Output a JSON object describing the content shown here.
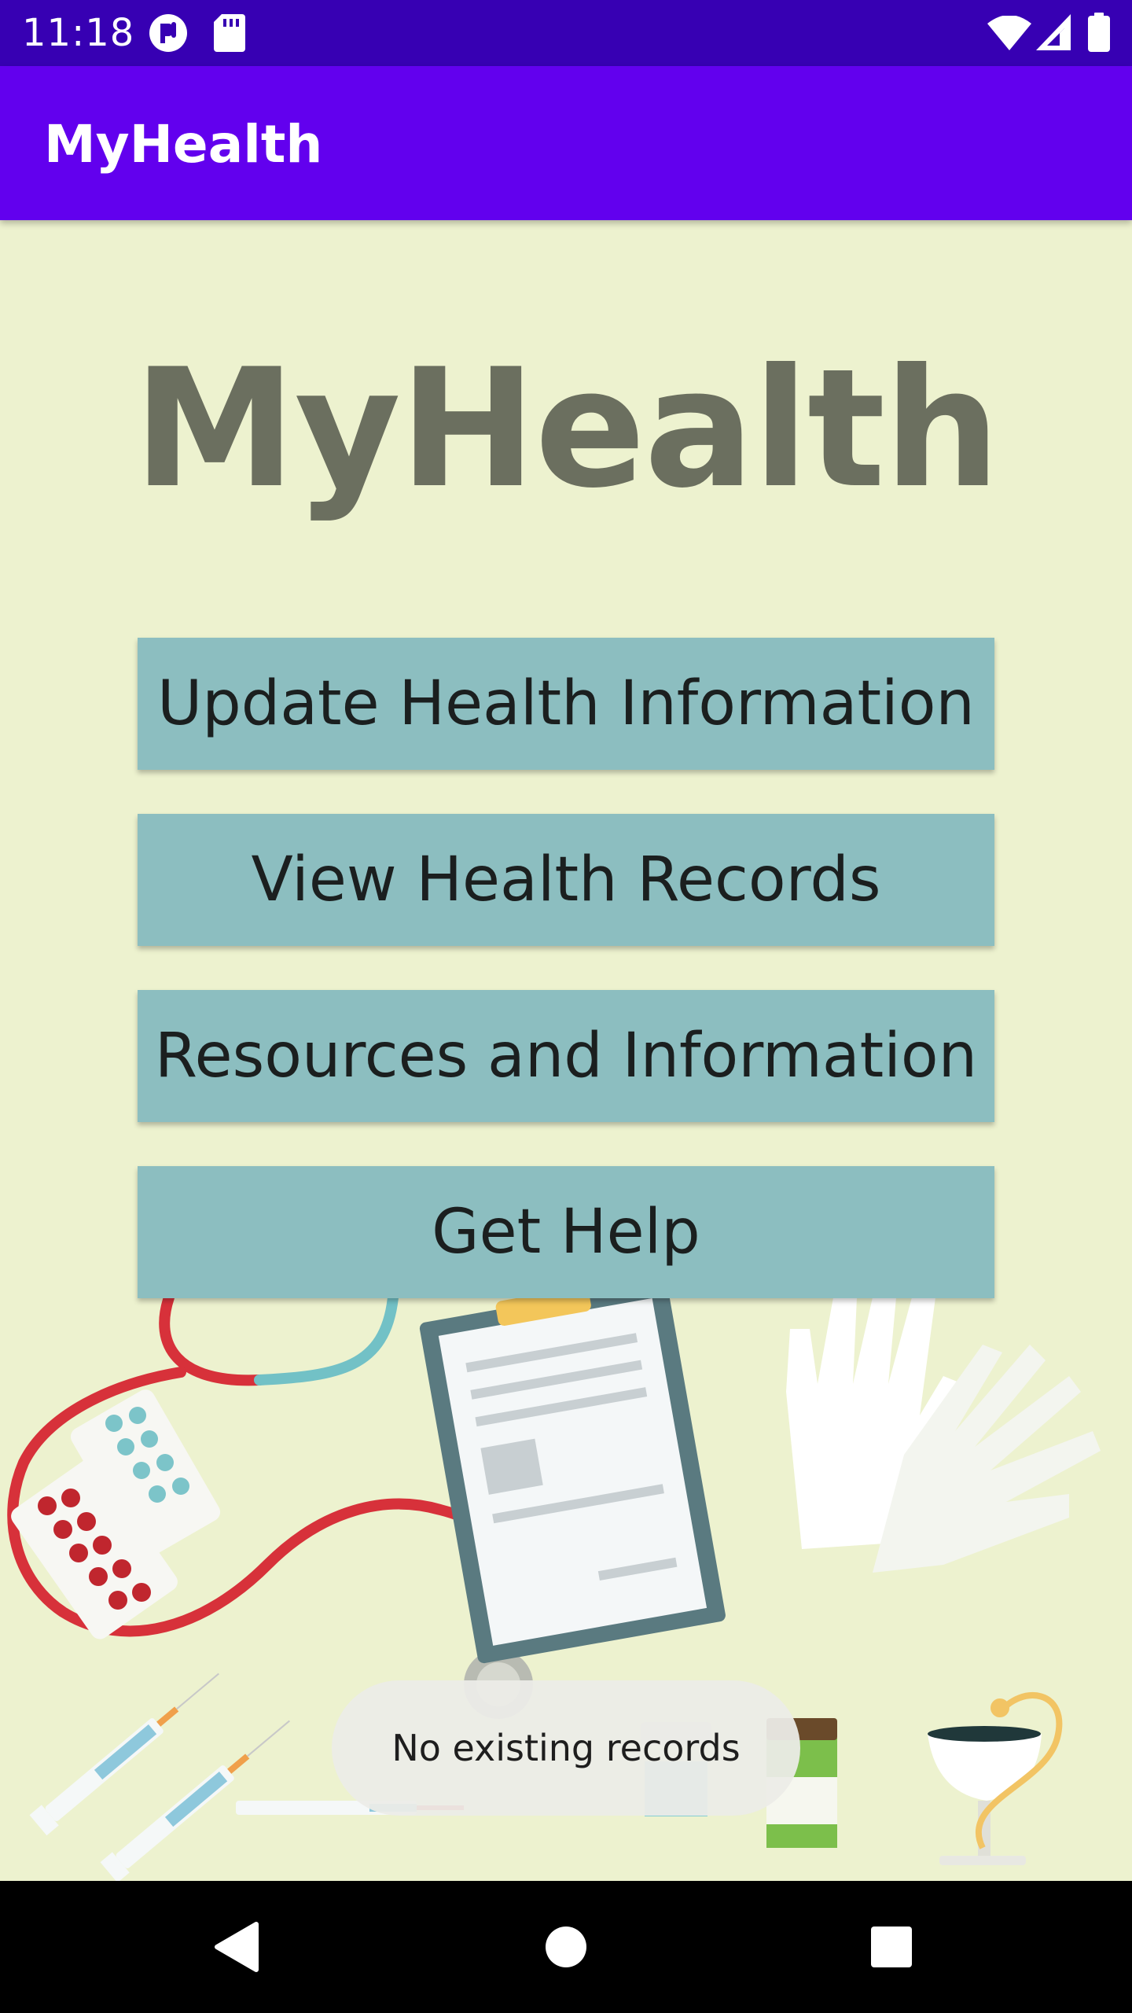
{
  "status_bar": {
    "time": "11:18",
    "icons": [
      "app-notification-icon",
      "sd-card-icon",
      "wifi-icon",
      "cell-signal-icon",
      "battery-icon"
    ]
  },
  "app_bar": {
    "title": "MyHealth"
  },
  "main": {
    "title": "MyHealth",
    "buttons": [
      {
        "label": "Update Health Information"
      },
      {
        "label": "View Health Records"
      },
      {
        "label": "Resources and Information"
      },
      {
        "label": "Get Help"
      }
    ]
  },
  "toast": {
    "message": "No existing records"
  },
  "nav_bar": {
    "buttons": [
      "back-icon",
      "home-icon",
      "recents-icon"
    ]
  },
  "colors": {
    "status_bar": "#3700b3",
    "app_bar": "#6200ee",
    "background": "#edf2cf",
    "button": "#8cbec0",
    "title_text": "#6b6f5f"
  }
}
